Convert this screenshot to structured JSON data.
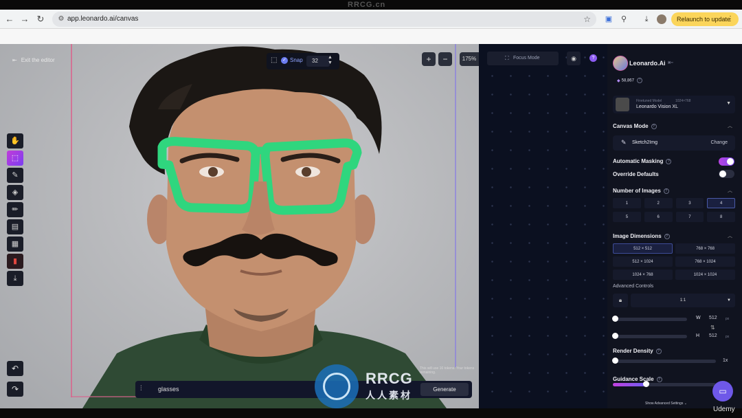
{
  "watermark_top": "RRCG.cn",
  "browser": {
    "url": "app.leonardo.ai/canvas",
    "relaunch_label": "Relaunch to update"
  },
  "canvas": {
    "exit_label": "Exit the editor",
    "snap_label": "Snap",
    "snap_value": "32",
    "zoom_level": "175%",
    "prompt_text": "glasses",
    "generate_label": "Generate",
    "token_note": "This will use 16 tokens. Your tokens remaining."
  },
  "middle": {
    "focus_mode_label": "Focus Mode"
  },
  "panel": {
    "brand": "Leonardo.Ai",
    "tokens": "58,867",
    "model_caption": "Finetuned Model",
    "model_res": "1024×768",
    "model_name": "Leonardo Vision XL",
    "canvas_mode_title": "Canvas Mode",
    "canvas_mode_value": "Sketch2Img",
    "change_label": "Change",
    "auto_masking_label": "Automatic Masking",
    "auto_masking_on": true,
    "override_defaults_label": "Override Defaults",
    "override_defaults_on": false,
    "num_images_title": "Number of Images",
    "num_images": [
      "1",
      "2",
      "3",
      "4",
      "5",
      "6",
      "7",
      "8"
    ],
    "num_images_selected": "4",
    "image_dimensions_title": "Image Dimensions",
    "dimensions": [
      "512 × 512",
      "768 × 768",
      "512 × 1024",
      "768 × 1024",
      "1024 × 768",
      "1024 × 1024"
    ],
    "dimension_selected": "512 × 512",
    "advanced_controls_label": "Advanced Controls",
    "aspect_ratio": "1:1",
    "width_label": "W",
    "width_value": "512",
    "height_label": "H",
    "height_value": "512",
    "px_unit": "px",
    "render_density_title": "Render Density",
    "render_density_value": "1x",
    "guidance_scale_title": "Guidance Scale",
    "guidance_scale_fraction": 0.32,
    "show_advanced_label": "Show Advanced Settings"
  },
  "watermark": {
    "main": "RRCG",
    "sub": "人人素材"
  },
  "footer": {
    "udemy": "Udemy"
  },
  "colors": {
    "accent": "#8b45e8",
    "frame_pink": "#d9648d",
    "frame_blue": "#8a7fe0",
    "glasses_green": "#2fd67e"
  }
}
